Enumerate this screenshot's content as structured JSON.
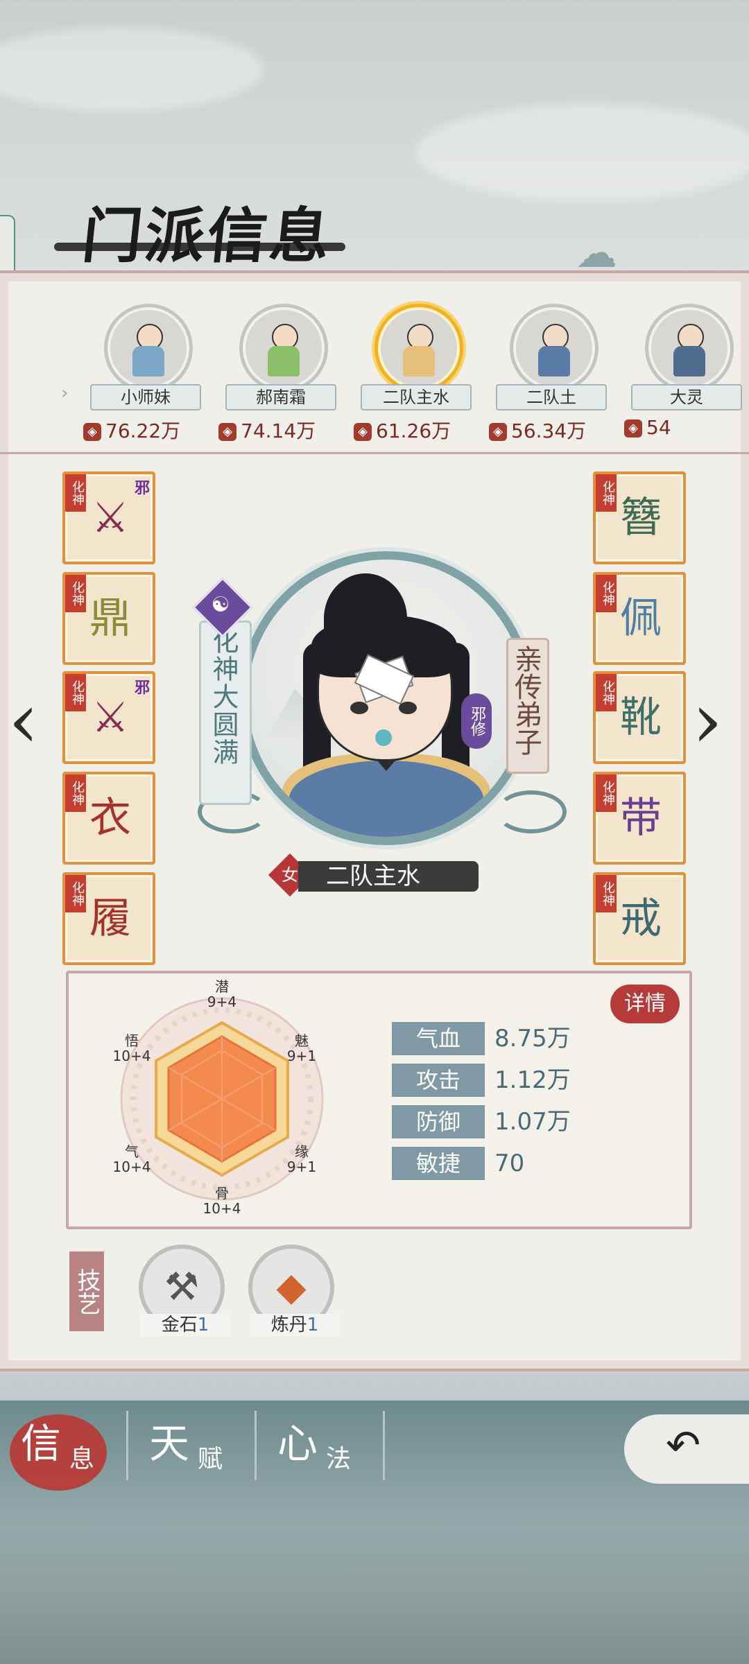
{
  "page_title": "门派信息",
  "roster": [
    {
      "name": "小师妹",
      "power": "76.22万",
      "active": false,
      "color": "#7ca7c7"
    },
    {
      "name": "郝南霜",
      "power": "74.14万",
      "active": false,
      "color": "#8bbf6a"
    },
    {
      "name": "二队主水",
      "power": "61.26万",
      "active": true,
      "color": "#e4c07a"
    },
    {
      "name": "二队土",
      "power": "56.34万",
      "active": false,
      "color": "#5a7ca6"
    },
    {
      "name": "大灵",
      "power": "54",
      "active": false,
      "color": "#4f6e8f"
    }
  ],
  "character": {
    "name": "二队主水",
    "gender": "女",
    "realm": "化神大圆满",
    "title": "亲传弟子",
    "sect_type": "邪修"
  },
  "equipment": {
    "left": [
      {
        "rank": "化神",
        "evil": "邪",
        "icon": "dagger-icon"
      },
      {
        "rank": "化神",
        "evil": "",
        "icon": "cauldron-icon"
      },
      {
        "rank": "化神",
        "evil": "邪",
        "icon": "dagger-icon"
      },
      {
        "rank": "化神",
        "evil": "",
        "icon": "robe-icon"
      },
      {
        "rank": "化神",
        "evil": "",
        "icon": "boot-icon"
      }
    ],
    "right": [
      {
        "rank": "化神",
        "evil": "",
        "icon": "hairpin-icon"
      },
      {
        "rank": "化神",
        "evil": "",
        "icon": "pendant-icon"
      },
      {
        "rank": "化神",
        "evil": "",
        "icon": "shoe-icon"
      },
      {
        "rank": "化神",
        "evil": "",
        "icon": "belt-icon"
      },
      {
        "rank": "化神",
        "evil": "",
        "icon": "ring-icon"
      }
    ]
  },
  "attributes": {
    "qian": {
      "name": "潜",
      "value": "9+4"
    },
    "mei": {
      "name": "魅",
      "value": "9+1"
    },
    "yuan": {
      "name": "缘",
      "value": "9+1"
    },
    "gu": {
      "name": "骨",
      "value": "10+4"
    },
    "qi": {
      "name": "气",
      "value": "10+4"
    },
    "wu": {
      "name": "悟",
      "value": "10+4"
    }
  },
  "details_label": "详情",
  "stats": [
    {
      "label": "气血",
      "value": "8.75万"
    },
    {
      "label": "攻击",
      "value": "1.12万"
    },
    {
      "label": "防御",
      "value": "1.07万"
    },
    {
      "label": "敏捷",
      "value": "70"
    }
  ],
  "skills_label": "技艺",
  "skills": [
    {
      "name": "金石",
      "level": "1",
      "icon": "hammer-icon"
    },
    {
      "name": "炼丹",
      "level": "1",
      "icon": "pill-icon"
    }
  ],
  "tabs": [
    {
      "big": "信",
      "small": "息",
      "active": true
    },
    {
      "big": "天",
      "small": "赋",
      "active": false
    },
    {
      "big": "心",
      "small": "法",
      "active": false
    }
  ],
  "colors": {
    "accent_red": "#b73a3a",
    "slot_border": "#e0913b",
    "active_ring": "#f2b21f",
    "stat_label": "#7f9aa4"
  }
}
